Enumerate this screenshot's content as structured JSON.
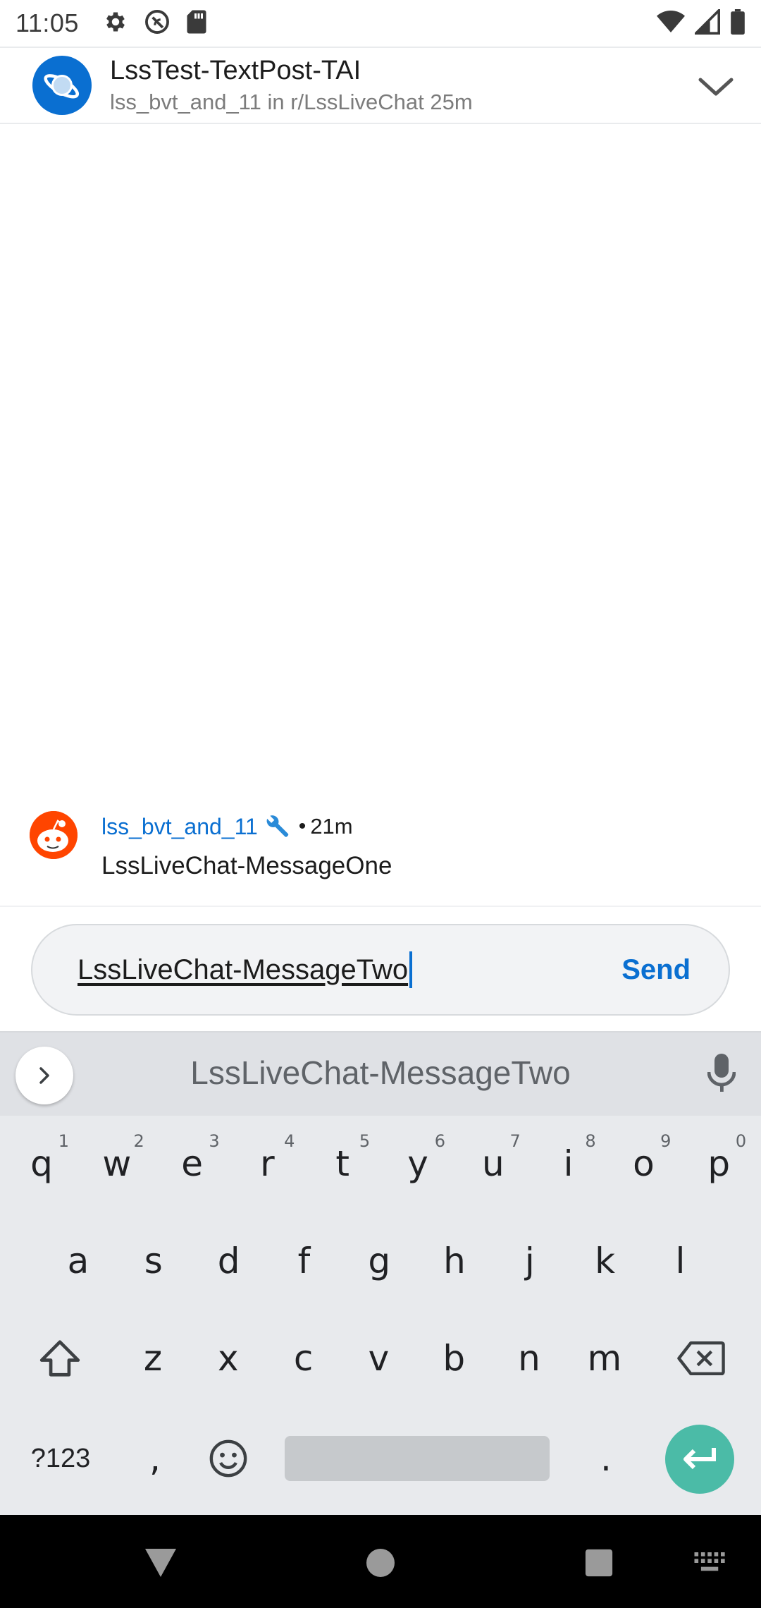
{
  "status_bar": {
    "time": "11:05",
    "left_icons": [
      "gear-icon",
      "do-not-disturb-icon",
      "sd-card-icon"
    ],
    "right_icons": [
      "wifi-icon",
      "cell-signal-icon",
      "battery-icon"
    ]
  },
  "post": {
    "title": "LssTest-TextPost-TAI",
    "subtitle": "lss_bvt_and_11 in r/LssLiveChat 25m",
    "subreddit_icon": "planet-icon",
    "collapse_icon": "chevron-down-icon"
  },
  "messages": [
    {
      "author": "lss_bvt_and_11",
      "mod_badge_icon": "wrench-icon",
      "separator": "•",
      "time": "21m",
      "text": "LssLiveChat-MessageOne"
    }
  ],
  "composer": {
    "value": "LssLiveChat-MessageTwo",
    "send_label": "Send"
  },
  "colors": {
    "accent": "#0a6fd1",
    "mod_orange": "#ff4500",
    "enter_key": "#4bbba7"
  },
  "keyboard": {
    "suggestion": "LssLiveChat-MessageTwo",
    "row1": [
      {
        "k": "q",
        "h": "1"
      },
      {
        "k": "w",
        "h": "2"
      },
      {
        "k": "e",
        "h": "3"
      },
      {
        "k": "r",
        "h": "4"
      },
      {
        "k": "t",
        "h": "5"
      },
      {
        "k": "y",
        "h": "6"
      },
      {
        "k": "u",
        "h": "7"
      },
      {
        "k": "i",
        "h": "8"
      },
      {
        "k": "o",
        "h": "9"
      },
      {
        "k": "p",
        "h": "0"
      }
    ],
    "row2": [
      "a",
      "s",
      "d",
      "f",
      "g",
      "h",
      "j",
      "k",
      "l"
    ],
    "row3": [
      "z",
      "x",
      "c",
      "v",
      "b",
      "n",
      "m"
    ],
    "symbols_label": "?123",
    "comma": ",",
    "period": "."
  },
  "nav_bar": [
    "back-icon",
    "home-icon",
    "recents-icon",
    "keyboard-switch-icon"
  ]
}
